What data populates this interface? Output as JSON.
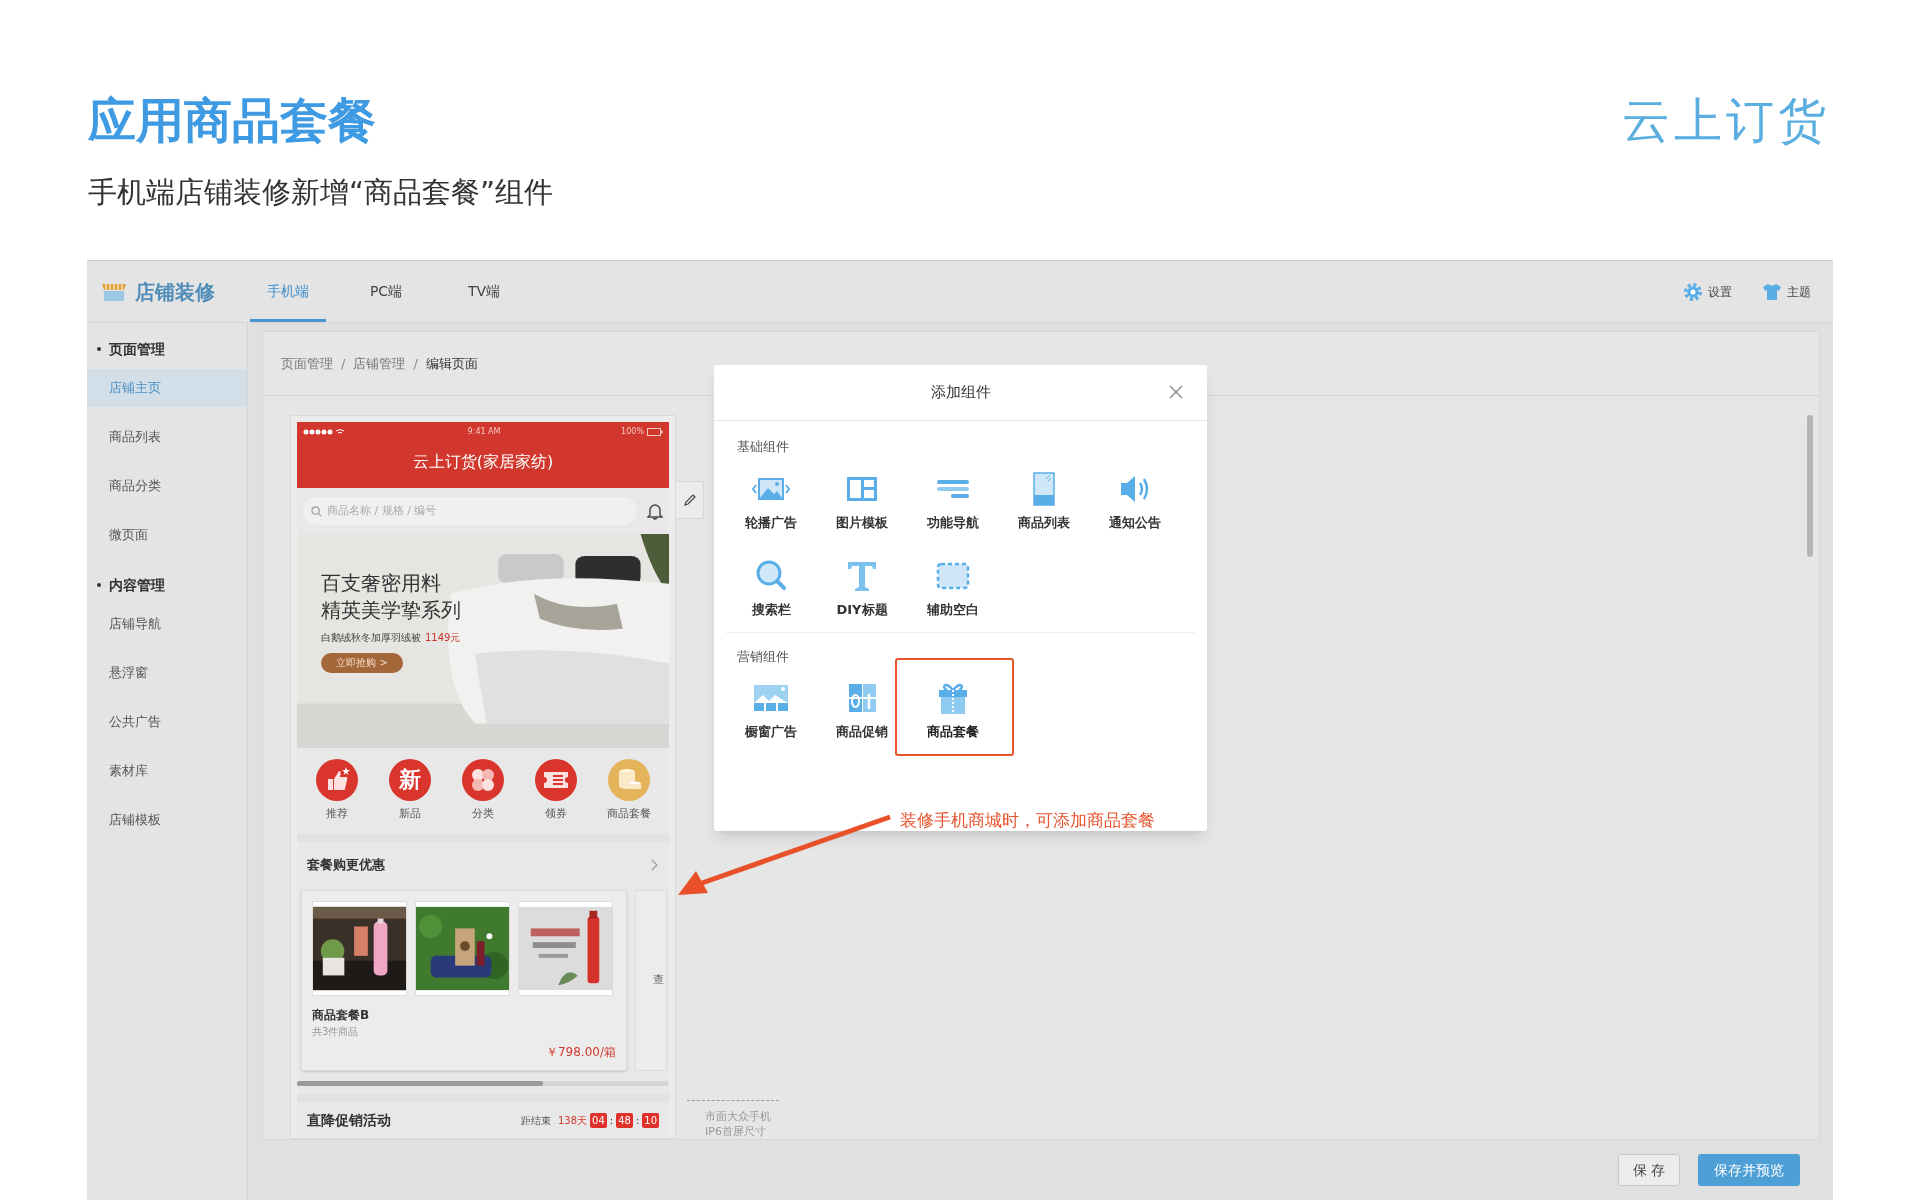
{
  "slide": {
    "title": "应用商品套餐",
    "subtitle": "手机端店铺装修新增“商品套餐”组件",
    "logo": "云上订货"
  },
  "app": {
    "brand": "店铺装修",
    "tabs": [
      {
        "label": "手机端",
        "selected": true
      },
      {
        "label": "PC端",
        "selected": false
      },
      {
        "label": "TV端",
        "selected": false
      }
    ],
    "toolbar": [
      {
        "label": "设置",
        "kind": "gear"
      },
      {
        "label": "主题",
        "kind": "shirt"
      }
    ]
  },
  "sidebar": {
    "sections": [
      {
        "title": "页面管理",
        "items": [
          {
            "label": "店铺主页",
            "selected": true
          },
          {
            "label": "商品列表",
            "selected": false
          },
          {
            "label": "商品分类",
            "selected": false
          },
          {
            "label": "微页面",
            "selected": false
          }
        ]
      },
      {
        "title": "内容管理",
        "items": [
          {
            "label": "店铺导航",
            "selected": false
          },
          {
            "label": "悬浮窗",
            "selected": false
          },
          {
            "label": "公共广告",
            "selected": false
          },
          {
            "label": "素材库",
            "selected": false
          },
          {
            "label": "店铺模板",
            "selected": false
          }
        ]
      }
    ]
  },
  "breadcrumb": {
    "items": [
      "页面管理",
      "店铺管理",
      "编辑页面"
    ],
    "separator": "/"
  },
  "phone": {
    "status_bar": {
      "time": "9:41 AM",
      "battery": "100%"
    },
    "title": "云上订货(家居家纺)",
    "search": {
      "placeholder": "商品名称 / 规格 / 编号"
    },
    "banner": {
      "headline": [
        "百支奢密用料",
        "精英美学挚系列"
      ],
      "caption": "白鹅绒秋冬加厚羽绒被",
      "price": "1149元",
      "button": "立即抢购 >"
    },
    "nav": [
      {
        "label": "推荐",
        "kind": "thumb"
      },
      {
        "label": "新品",
        "kind": "glyph",
        "glyph": "新"
      },
      {
        "label": "分类",
        "kind": "clover"
      },
      {
        "label": "领券",
        "kind": "ticket"
      },
      {
        "label": "商品套餐",
        "kind": "coins"
      }
    ],
    "bundle_section": {
      "title": "套餐购更优惠",
      "card": {
        "name": "商品套餐B",
        "count": "共3件商品",
        "price": "￥798.00/箱"
      },
      "next_card_text": "查"
    },
    "promo": {
      "title": "直降促销活动",
      "label": "距结束",
      "days": "138天",
      "time": [
        "04",
        "48",
        "10"
      ],
      "separator": ":"
    }
  },
  "size_note": {
    "lines": [
      "市面大众手机",
      "IP6首屏尺寸"
    ]
  },
  "dialog": {
    "title": "添加组件",
    "sections": [
      {
        "title": "基础组件",
        "items": [
          {
            "label": "轮播广告",
            "kind": "carousel",
            "highlighted": false
          },
          {
            "label": "图片模板",
            "kind": "image-grid",
            "highlighted": false
          },
          {
            "label": "功能导航",
            "kind": "nav",
            "highlighted": false
          },
          {
            "label": "商品列表",
            "kind": "product-list",
            "highlighted": false
          },
          {
            "label": "通知公告",
            "kind": "notice",
            "highlighted": false
          },
          {
            "label": "搜索栏",
            "kind": "search",
            "highlighted": false
          },
          {
            "label": "DIY标题",
            "kind": "title",
            "highlighted": false
          },
          {
            "label": "辅助空白",
            "kind": "spacer",
            "highlighted": false
          }
        ]
      },
      {
        "title": "营销组件",
        "items": [
          {
            "label": "橱窗广告",
            "kind": "showcase",
            "highlighted": false
          },
          {
            "label": "商品促销",
            "kind": "promotion",
            "highlighted": false
          },
          {
            "label": "商品套餐",
            "kind": "bundle",
            "highlighted": true
          }
        ]
      }
    ]
  },
  "annotation": "装修手机商城时，可添加商品套餐",
  "footer_buttons": [
    {
      "label": "保 存",
      "kind": "default"
    },
    {
      "label": "保存并预览",
      "kind": "primary"
    }
  ]
}
